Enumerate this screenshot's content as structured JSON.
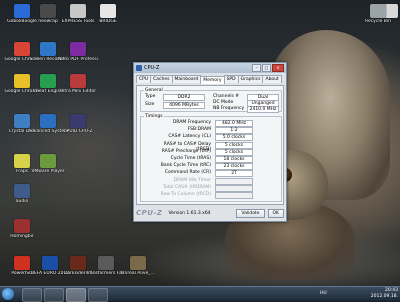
{
  "desktop": {
    "icons": [
      {
        "label": "GoboliBoogle",
        "color": "#2b6ad6"
      },
      {
        "label": "neowrap",
        "color": "#4a4a4a"
      },
      {
        "label": "EXPRESS Tools ",
        "color": "#c7c7c7"
      },
      {
        "label": "BRIDGE ",
        "color": "#e6e6e6"
      },
      {
        "label": "",
        "color": "#d8d8d8"
      },
      {
        "label": "Recycle Bin",
        "color": "#9aa3a8"
      },
      {
        "label": "Google Chrome",
        "color": "#d84436"
      },
      {
        "label": "Screen Recorder",
        "color": "#2f78c8"
      },
      {
        "label": "Nitro PDF Professional",
        "color": "#7e2aa0"
      },
      {
        "label": "Google Chrome",
        "color": "#e8c12a"
      },
      {
        "label": "Cheat Engine",
        "color": "#26a04e"
      },
      {
        "label": "Ultra Mini Editor",
        "color": "#b83a3a"
      },
      {
        "label": "Crystal Disk",
        "color": "#3d7fc2"
      },
      {
        "label": "Advanced SystemCare",
        "color": "#2a6fc0"
      },
      {
        "label": "CPUID CPU-Z",
        "color": "#3a3a6e"
      },
      {
        "label": "Fraps",
        "color": "#d8d24a"
      },
      {
        "label": "VMware Player",
        "color": "#6c9b3e"
      },
      {
        "label": "audio",
        "color": "#3f5b8c"
      },
      {
        "label": "Homingbir",
        "color": "#9a3030"
      },
      {
        "label": "PowerISO",
        "color": "#d03020"
      },
      {
        "label": "UEFA EURO 2012",
        "color": "#1b4fa5"
      },
      {
        "label": "Darksiders II",
        "color": "#6a2a1a"
      },
      {
        "label": "Transformers Fall of Cyb...",
        "color": "#5a5a5a"
      },
      {
        "label": "Unreal Alive_...",
        "color": "#7a6a4a"
      }
    ],
    "top_right_label": "Recycle Bin"
  },
  "cpuz": {
    "title": "CPU-Z",
    "tabs": [
      "CPU",
      "Caches",
      "Mainboard",
      "Memory",
      "SPD",
      "Graphics",
      "About"
    ],
    "active_tab": "Memory",
    "general": {
      "title": "General",
      "type_label": "Type",
      "type_value": "DDR2",
      "size_label": "Size",
      "size_value": "4096 MBytes",
      "channels_label": "Channels #",
      "channels_value": "Dual",
      "dc_mode_label": "DC Mode",
      "dc_mode_value": "Unganged",
      "nb_freq_label": "NB Frequency",
      "nb_freq_value": "2410.0 MHz"
    },
    "timings": {
      "title": "Timings",
      "rows": [
        {
          "label": "DRAM Frequency",
          "value": "482.0 MHz"
        },
        {
          "label": "FSB:DRAM",
          "value": "1:2"
        },
        {
          "label": "CAS# Latency (CL)",
          "value": "5.0 clocks"
        },
        {
          "label": "RAS# to CAS# Delay (tRCD)",
          "value": "5 clocks"
        },
        {
          "label": "RAS# Precharge (tRP)",
          "value": "5 clocks"
        },
        {
          "label": "Cycle Time (tRAS)",
          "value": "18 clocks"
        },
        {
          "label": "Bank Cycle Time (tRC)",
          "value": "23 clocks"
        },
        {
          "label": "Command Rate (CR)",
          "value": "2T"
        },
        {
          "label": "DRAM Idle Timer",
          "value": ""
        },
        {
          "label": "Total CAS# (tRDRAM)",
          "value": ""
        },
        {
          "label": "Row To Column (tRCD)",
          "value": ""
        }
      ]
    },
    "brand": "CPU-Z",
    "version": "Version 1.61.3.x64",
    "validate_label": "Validate",
    "ok_label": "OK"
  },
  "taskbar": {
    "language": "HU",
    "time": "20:43",
    "date": "2012.09.18."
  }
}
